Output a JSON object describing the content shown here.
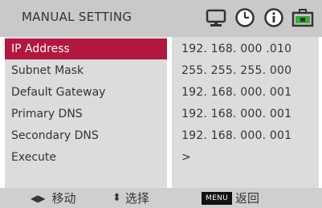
{
  "header": {
    "title": "MANUAL SETTING",
    "icons": [
      "monitor-icon",
      "clock-icon",
      "info-icon",
      "toolbox-icon"
    ]
  },
  "rows": [
    {
      "label": "IP Address",
      "value": "192. 168. 000 .010",
      "selected": true
    },
    {
      "label": "Subnet Mask",
      "value": "255. 255. 255. 000",
      "selected": false
    },
    {
      "label": "Default Gateway",
      "value": "192. 168. 000. 001",
      "selected": false
    },
    {
      "label": "Primary DNS",
      "value": "192. 168. 000. 001",
      "selected": false
    },
    {
      "label": "Secondary DNS",
      "value": "192. 168. 000. 001",
      "selected": false
    },
    {
      "label": "Execute",
      "value": ">",
      "selected": false
    }
  ],
  "footer": {
    "move_symbol": "◀▶",
    "move_label": "移动",
    "select_symbol": "⬍",
    "select_label": "选择",
    "menu_key": "MENU",
    "back_label": "返回"
  },
  "colors": {
    "selection": "#b3163f",
    "panel": "#dcdcdc",
    "header": "#c9c9c9",
    "toolbox_fill": "#3aa83a"
  }
}
